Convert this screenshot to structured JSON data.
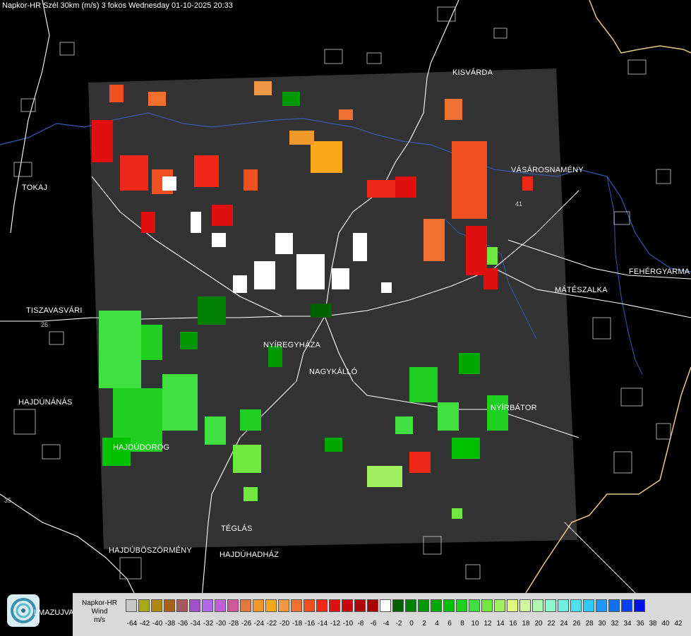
{
  "title": "Napkor-HR Szél 30km (m/s) 3 fokos Wednesday 01-10-2025 20:33",
  "cities": [
    {
      "id": "kisvarda",
      "name": "KISVÁRDA"
    },
    {
      "id": "vasarosnameny",
      "name": "VÁSÁROSNAMÉNY"
    },
    {
      "id": "tokaj",
      "name": "TOKAJ"
    },
    {
      "id": "fehergyarmat",
      "name": "FEHÉRGYARMA"
    },
    {
      "id": "mateszalka",
      "name": "MÁTÉSZALKA"
    },
    {
      "id": "tiszavasvari",
      "name": "TISZAVASVÁRI"
    },
    {
      "id": "nyiregyhaza",
      "name": "NYÍREGYHÁZA"
    },
    {
      "id": "nagykallo",
      "name": "NAGYKÁLLÓ"
    },
    {
      "id": "hajdunanas",
      "name": "HAJDÚNÁNÁS"
    },
    {
      "id": "nyirbator",
      "name": "NYÍRBÁTOR"
    },
    {
      "id": "hajdudorog",
      "name": "HAJDÚDOROG"
    },
    {
      "id": "teglas",
      "name": "TÉGLÁS"
    },
    {
      "id": "hajduboszormeny",
      "name": "HAJDÚBÖSZÖRMÉNY"
    },
    {
      "id": "hajduhadhaz",
      "name": "HAJDÚHADHÁZ"
    }
  ],
  "logo_text": "LMAZUJVAR",
  "legend": {
    "line1": "Napkor-HR",
    "line2": "Wind",
    "line3": "m/s",
    "colors": [
      "#c8c8c8",
      "#a8a81a",
      "#b0880f",
      "#a86018",
      "#a85860",
      "#a050c8",
      "#b068e8",
      "#c060d8",
      "#d05898",
      "#e07840",
      "#f09828",
      "#f8a818",
      "#f09848",
      "#f07030",
      "#f05020",
      "#f02818",
      "#e01010",
      "#c80808",
      "#b00808",
      "#a80000",
      "#ffffff",
      "#006000",
      "#008000",
      "#009800",
      "#00a800",
      "#00c000",
      "#20d020",
      "#40e040",
      "#70e840",
      "#a0f060",
      "#e0f880",
      "#d0f8a0",
      "#b0f8b0",
      "#90f8d0",
      "#70f0e0",
      "#50e0f0",
      "#30c8f8",
      "#2098f8",
      "#1070f0",
      "#0040f0",
      "#0010e8"
    ],
    "ticks": [
      "-64",
      "-42",
      "-40",
      "-38",
      "-36",
      "-34",
      "-32",
      "-30",
      "-28",
      "-26",
      "-24",
      "-22",
      "-20",
      "-18",
      "-16",
      "-14",
      "-12",
      "-10",
      "-8",
      "-6",
      "-4",
      "-2",
      "0",
      "2",
      "4",
      "6",
      "8",
      "10",
      "12",
      "14",
      "16",
      "18",
      "20",
      "22",
      "24",
      "26",
      "28",
      "30",
      "32",
      "34",
      "36",
      "38",
      "40",
      "42"
    ]
  },
  "road_numbers": [
    "26",
    "41",
    "35"
  ],
  "colors": {
    "radar_bg": "#333333",
    "border": "#5a7fd0",
    "river": "#3a5ab0",
    "frontier": "#e8c88a"
  }
}
